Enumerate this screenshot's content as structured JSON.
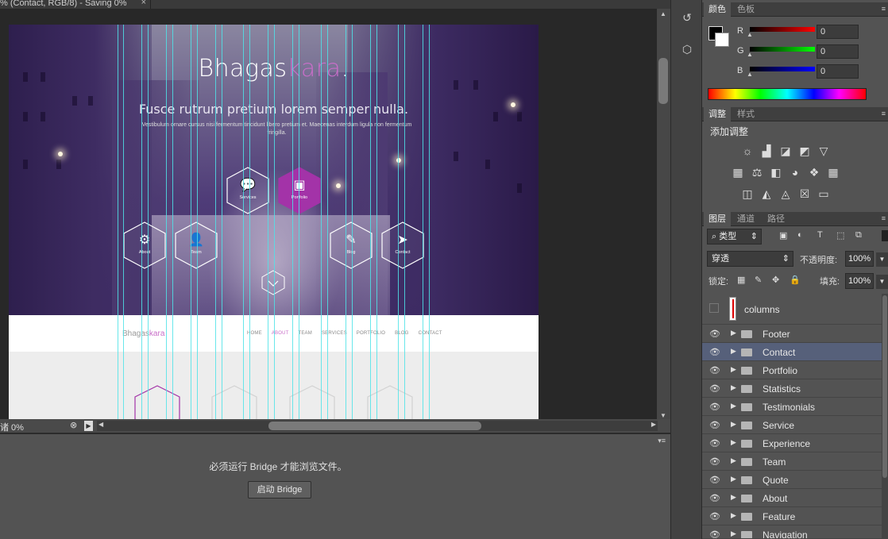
{
  "document": {
    "tab_title": "% (Contact, RGB/8) - Saving 0%",
    "zoom_status": "诸 0%"
  },
  "mockup": {
    "brand_main": "Bhagas",
    "brand_accent": "kara",
    "brand_dot": ".",
    "tagline": "Fusce rutrum pretium lorem semper nulla.",
    "subline": "Vestibulum ornare cursus nisi fermentum tincidunt libero pretium et. Maecenas interdum ligula non fermentum fringilla.",
    "hexes": [
      {
        "label": "Services",
        "icon": "chat-icon",
        "glyph": "💬",
        "active": false
      },
      {
        "label": "Portfolio",
        "icon": "portfolio-icon",
        "glyph": "▣",
        "active": true
      },
      {
        "label": "About",
        "icon": "gear-icon",
        "glyph": "⚙",
        "active": false
      },
      {
        "label": "Team",
        "icon": "user-icon",
        "glyph": "👤",
        "active": false
      },
      {
        "label": "Blog",
        "icon": "pencil-icon",
        "glyph": "✎",
        "active": false
      },
      {
        "label": "Contact",
        "icon": "send-icon",
        "glyph": "➤",
        "active": false
      }
    ],
    "nav_brand_main": "Bhagas",
    "nav_brand_accent": "kara",
    "nav_links": [
      "HOME",
      "ABOUT",
      "TEAM",
      "SERVICES",
      "PORTFOLIO",
      "BLOG",
      "CONTACT"
    ],
    "nav_active": "ABOUT",
    "accent_color": "#c86ec8"
  },
  "bridge": {
    "message": "必须运行 Bridge 才能浏览文件。",
    "button": "启动 Bridge"
  },
  "color_panel": {
    "tabs": [
      "颜色",
      "色板"
    ],
    "channels": [
      {
        "name": "R",
        "value": "0"
      },
      {
        "name": "G",
        "value": "0"
      },
      {
        "name": "B",
        "value": "0"
      }
    ]
  },
  "adjust_panel": {
    "tabs": [
      "调整",
      "样式"
    ],
    "title": "添加调整"
  },
  "layers_panel": {
    "tabs": [
      "图层",
      "通道",
      "路径"
    ],
    "filter_kind": "类型",
    "blend_mode": "穿透",
    "opacity_label": "不透明度:",
    "opacity_value": "100%",
    "lock_label": "锁定:",
    "fill_label": "填充:",
    "fill_value": "100%",
    "top_layer": "columns",
    "groups": [
      "Footer",
      "Contact",
      "Portfolio",
      "Statistics",
      "Testimonials",
      "Service",
      "Experience",
      "Team",
      "Quote",
      "About",
      "Feature",
      "Navigation"
    ],
    "selected": "Contact"
  }
}
